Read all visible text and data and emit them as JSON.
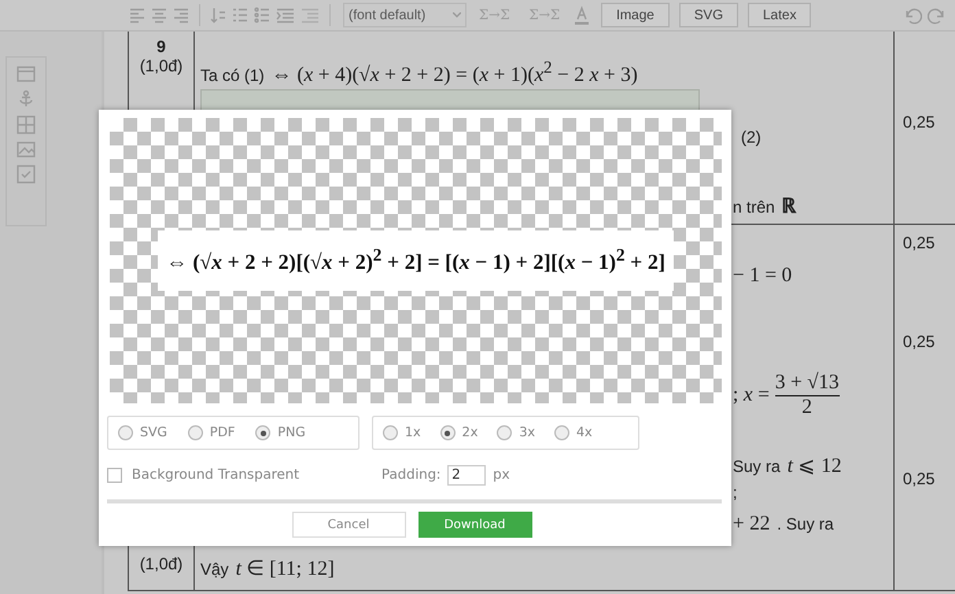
{
  "toolbar": {
    "font_select": "(font default)",
    "convert_buttons": [
      "Σ→Σ",
      "Σ→Σ"
    ],
    "export_buttons": [
      "Image",
      "SVG",
      "Latex"
    ]
  },
  "table": {
    "rows": [
      {
        "number": "9",
        "points": "(1,0đ)",
        "lines": [
          {
            "kind": "full",
            "parts": [
              {
                "kind": "text",
                "text": "Ta có (1)"
              },
              {
                "kind": "math",
                "text": "⇔ (*x* + 4)(√*x* + 2 + 2) = (*x* + 1)(*x*$^{2}$ − 2 *x* + 3)"
              }
            ]
          },
          {
            "kind": "box",
            "parts": [
              {
                "kind": "text",
                "text": "(2)"
              }
            ]
          },
          {
            "kind": "tail",
            "parts": [
              {
                "kind": "text",
                "text": "n trên"
              },
              {
                "kind": "math",
                "text": "**ℝ**"
              }
            ]
          }
        ],
        "scores": [
          "0,25"
        ]
      },
      {
        "points": "(1,0đ)",
        "lines": [
          {
            "kind": "tail",
            "parts": [
              {
                "kind": "math",
                "text": "− 1 = 0"
              }
            ]
          },
          {
            "kind": "tail",
            "parts": [
              {
                "kind": "math",
                "text": "; *x* ="
              },
              {
                "kind": "fraction",
                "numerator": "3 + √13",
                "denominator": "2"
              }
            ]
          },
          {
            "kind": "tail",
            "parts": [
              {
                "kind": "text",
                "text": "Suy ra"
              },
              {
                "kind": "math",
                "text": "*t* ⩽ 12"
              }
            ]
          },
          {
            "kind": "tail",
            "parts": [
              {
                "kind": "text",
                "text": ";"
              }
            ]
          },
          {
            "kind": "tail",
            "parts": [
              {
                "kind": "math",
                "text": "+ 22"
              },
              {
                "kind": "text",
                "text": ". Suy ra"
              }
            ]
          },
          {
            "kind": "full",
            "parts": [
              {
                "kind": "text",
                "text": "Vậy"
              },
              {
                "kind": "math",
                "text": "*t* ∈ [11; 12]"
              }
            ]
          }
        ],
        "scores": [
          "0,25",
          "0,25",
          "0,25"
        ]
      }
    ]
  },
  "dialog": {
    "preview": {
      "equation": "⇔ (√*x* + 2 + 2)[(√*x* + 2)$^{2}$ + 2] = [(*x* − 1) + 2][(*x* − 1)$^{2}$ + 2]"
    },
    "formats": [
      {
        "label": "SVG",
        "selected": false
      },
      {
        "label": "PDF",
        "selected": false
      },
      {
        "label": "PNG",
        "selected": true
      }
    ],
    "scales": [
      {
        "label": "1x",
        "selected": false
      },
      {
        "label": "2x",
        "selected": true
      },
      {
        "label": "3x",
        "selected": false
      },
      {
        "label": "4x",
        "selected": false
      }
    ],
    "background_transparent": {
      "label": "Background Transparent",
      "checked": false
    },
    "padding": {
      "label": "Padding:",
      "value": "2",
      "unit": "px"
    },
    "buttons": [
      {
        "label": "Cancel",
        "kind": "secondary"
      },
      {
        "label": "Download",
        "kind": "primary"
      }
    ]
  }
}
